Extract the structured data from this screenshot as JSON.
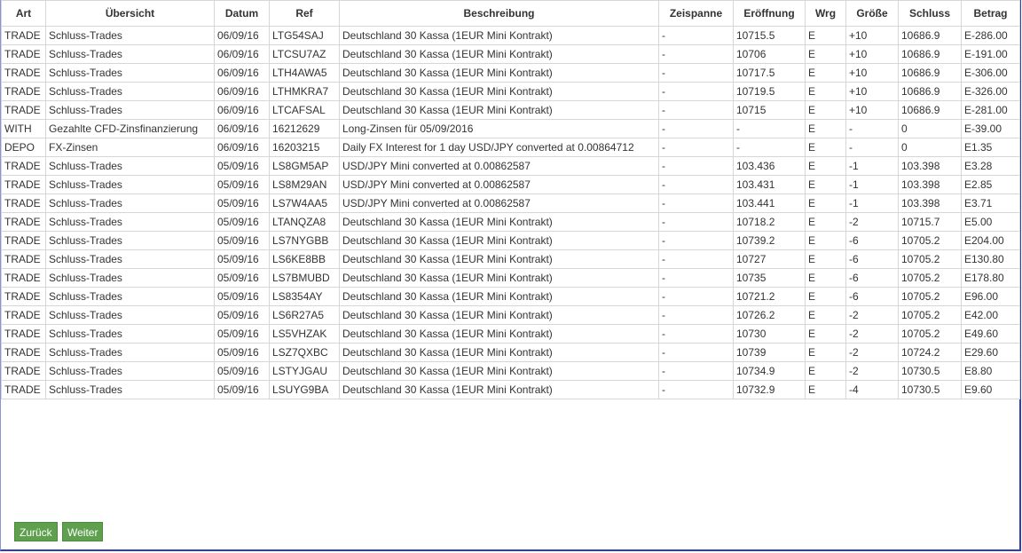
{
  "table": {
    "columns": [
      "Art",
      "Übersicht",
      "Datum",
      "Ref",
      "Beschreibung",
      "Zeispanne",
      "Eröffnung",
      "Wrg",
      "Größe",
      "Schluss",
      "Betrag"
    ],
    "rows": [
      [
        "TRADE",
        "Schluss-Trades",
        "06/09/16",
        "LTG54SAJ",
        "Deutschland 30 Kassa (1EUR Mini Kontrakt)",
        "-",
        "10715.5",
        "E",
        "+10",
        "10686.9",
        "E-286.00"
      ],
      [
        "TRADE",
        "Schluss-Trades",
        "06/09/16",
        "LTCSU7AZ",
        "Deutschland 30 Kassa (1EUR Mini Kontrakt)",
        "-",
        "10706",
        "E",
        "+10",
        "10686.9",
        "E-191.00"
      ],
      [
        "TRADE",
        "Schluss-Trades",
        "06/09/16",
        "LTH4AWA5",
        "Deutschland 30 Kassa (1EUR Mini Kontrakt)",
        "-",
        "10717.5",
        "E",
        "+10",
        "10686.9",
        "E-306.00"
      ],
      [
        "TRADE",
        "Schluss-Trades",
        "06/09/16",
        "LTHMKRA7",
        "Deutschland 30 Kassa (1EUR Mini Kontrakt)",
        "-",
        "10719.5",
        "E",
        "+10",
        "10686.9",
        "E-326.00"
      ],
      [
        "TRADE",
        "Schluss-Trades",
        "06/09/16",
        "LTCAFSAL",
        "Deutschland 30 Kassa (1EUR Mini Kontrakt)",
        "-",
        "10715",
        "E",
        "+10",
        "10686.9",
        "E-281.00"
      ],
      [
        "WITH",
        "Gezahlte CFD-Zinsfinanzierung",
        "06/09/16",
        "16212629",
        "Long-Zinsen für 05/09/2016",
        "-",
        "-",
        "E",
        "-",
        "0",
        "E-39.00"
      ],
      [
        "DEPO",
        "FX-Zinsen",
        "06/09/16",
        "16203215",
        "Daily FX Interest for 1 day USD/JPY converted at 0.00864712",
        "-",
        "-",
        "E",
        "-",
        "0",
        "E1.35"
      ],
      [
        "TRADE",
        "Schluss-Trades",
        "05/09/16",
        "LS8GM5AP",
        "USD/JPY Mini converted at 0.00862587",
        "-",
        "103.436",
        "E",
        "-1",
        "103.398",
        "E3.28"
      ],
      [
        "TRADE",
        "Schluss-Trades",
        "05/09/16",
        "LS8M29AN",
        "USD/JPY Mini converted at 0.00862587",
        "-",
        "103.431",
        "E",
        "-1",
        "103.398",
        "E2.85"
      ],
      [
        "TRADE",
        "Schluss-Trades",
        "05/09/16",
        "LS7W4AA5",
        "USD/JPY Mini converted at 0.00862587",
        "-",
        "103.441",
        "E",
        "-1",
        "103.398",
        "E3.71"
      ],
      [
        "TRADE",
        "Schluss-Trades",
        "05/09/16",
        "LTANQZA8",
        "Deutschland 30 Kassa (1EUR Mini Kontrakt)",
        "-",
        "10718.2",
        "E",
        "-2",
        "10715.7",
        "E5.00"
      ],
      [
        "TRADE",
        "Schluss-Trades",
        "05/09/16",
        "LS7NYGBB",
        "Deutschland 30 Kassa (1EUR Mini Kontrakt)",
        "-",
        "10739.2",
        "E",
        "-6",
        "10705.2",
        "E204.00"
      ],
      [
        "TRADE",
        "Schluss-Trades",
        "05/09/16",
        "LS6KE8BB",
        "Deutschland 30 Kassa (1EUR Mini Kontrakt)",
        "-",
        "10727",
        "E",
        "-6",
        "10705.2",
        "E130.80"
      ],
      [
        "TRADE",
        "Schluss-Trades",
        "05/09/16",
        "LS7BMUBD",
        "Deutschland 30 Kassa (1EUR Mini Kontrakt)",
        "-",
        "10735",
        "E",
        "-6",
        "10705.2",
        "E178.80"
      ],
      [
        "TRADE",
        "Schluss-Trades",
        "05/09/16",
        "LS8354AY",
        "Deutschland 30 Kassa (1EUR Mini Kontrakt)",
        "-",
        "10721.2",
        "E",
        "-6",
        "10705.2",
        "E96.00"
      ],
      [
        "TRADE",
        "Schluss-Trades",
        "05/09/16",
        "LS6R27A5",
        "Deutschland 30 Kassa (1EUR Mini Kontrakt)",
        "-",
        "10726.2",
        "E",
        "-2",
        "10705.2",
        "E42.00"
      ],
      [
        "TRADE",
        "Schluss-Trades",
        "05/09/16",
        "LS5VHZAK",
        "Deutschland 30 Kassa (1EUR Mini Kontrakt)",
        "-",
        "10730",
        "E",
        "-2",
        "10705.2",
        "E49.60"
      ],
      [
        "TRADE",
        "Schluss-Trades",
        "05/09/16",
        "LSZ7QXBC",
        "Deutschland 30 Kassa (1EUR Mini Kontrakt)",
        "-",
        "10739",
        "E",
        "-2",
        "10724.2",
        "E29.60"
      ],
      [
        "TRADE",
        "Schluss-Trades",
        "05/09/16",
        "LSTYJGAU",
        "Deutschland 30 Kassa (1EUR Mini Kontrakt)",
        "-",
        "10734.9",
        "E",
        "-2",
        "10730.5",
        "E8.80"
      ],
      [
        "TRADE",
        "Schluss-Trades",
        "05/09/16",
        "LSUYG9BA",
        "Deutschland 30 Kassa (1EUR Mini Kontrakt)",
        "-",
        "10732.9",
        "E",
        "-4",
        "10730.5",
        "E9.60"
      ]
    ]
  },
  "pagination": {
    "back_label": "Zurück",
    "next_label": "Weiter"
  },
  "colors": {
    "button_bg": "#5fa04e",
    "frame_border": "#2c3fb4",
    "grid_line": "#d6d6d6"
  }
}
